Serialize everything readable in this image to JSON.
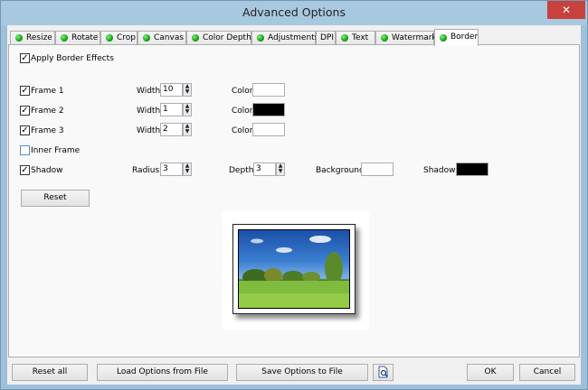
{
  "window": {
    "title": "Advanced Options",
    "close_glyph": "✕"
  },
  "tabs": [
    {
      "label": "Resize"
    },
    {
      "label": "Rotate"
    },
    {
      "label": "Crop"
    },
    {
      "label": "Canvas"
    },
    {
      "label": "Color Depth"
    },
    {
      "label": "Adjustments"
    },
    {
      "label": "DPI"
    },
    {
      "label": "Text"
    },
    {
      "label": "Watermark"
    },
    {
      "label": "Border"
    }
  ],
  "active_tab": "Border",
  "border": {
    "apply_label": "Apply Border Effects",
    "apply_checked": true,
    "frames": [
      {
        "label": "Frame 1",
        "checked": true,
        "width_label": "Width:",
        "width": "10",
        "color_label": "Color:",
        "color": "#ffffff"
      },
      {
        "label": "Frame 2",
        "checked": true,
        "width_label": "Width:",
        "width": "1",
        "color_label": "Color:",
        "color": "#000000"
      },
      {
        "label": "Frame 3",
        "checked": true,
        "width_label": "Width:",
        "width": "2",
        "color_label": "Color:",
        "color": "#ffffff"
      }
    ],
    "inner_frame": {
      "label": "Inner Frame",
      "checked": false
    },
    "shadow": {
      "label": "Shadow",
      "checked": true,
      "radius_label": "Radius:",
      "radius": "3",
      "depth_label": "Depth:",
      "depth": "3",
      "background_label": "Background:",
      "background_color": "#ffffff",
      "shadow_label": "Shadow:",
      "shadow_color": "#000000"
    },
    "reset_label": "Reset"
  },
  "footer": {
    "reset_all": "Reset all",
    "load": "Load Options from File",
    "save": "Save Options to File",
    "ok": "OK",
    "cancel": "Cancel"
  },
  "colors": {
    "active_dot": "#14a014",
    "titlebar": "#a8c8e0",
    "close_button": "#c8413c"
  },
  "icons": {
    "tab_status": "green-dot-icon",
    "preview_file": "file-magnifier-icon",
    "close": "close-icon"
  }
}
